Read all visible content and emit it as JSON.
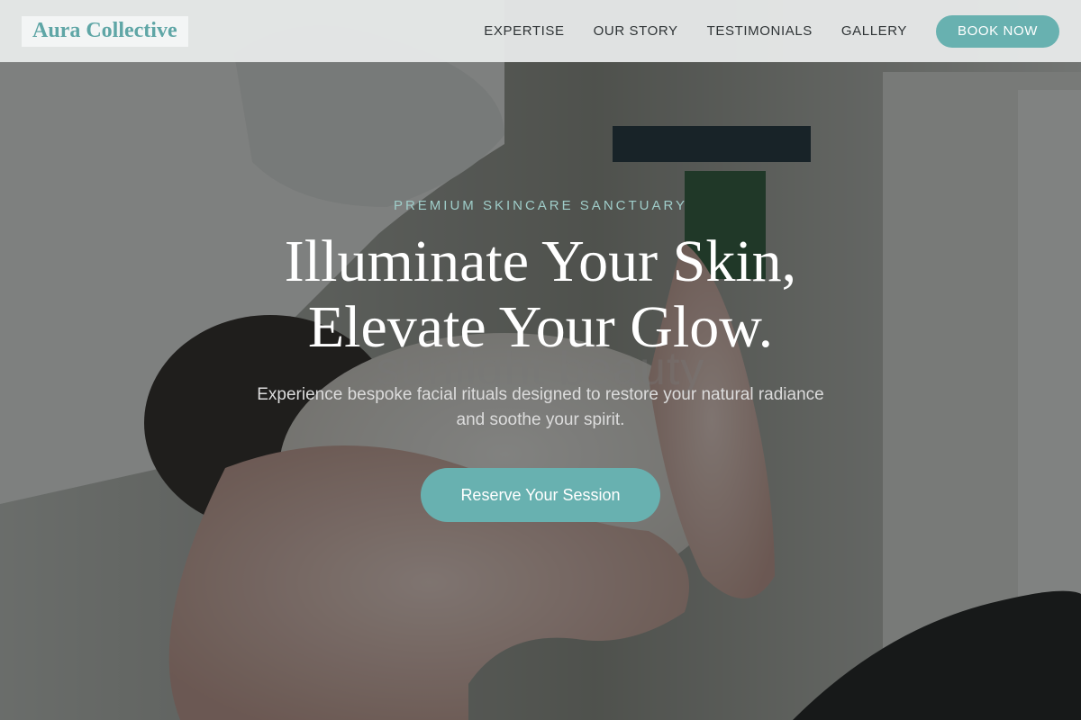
{
  "brand": {
    "name": "Aura Collective",
    "accent_color": "#68b1b0"
  },
  "nav": {
    "links": [
      "EXPERTISE",
      "OUR STORY",
      "TESTIMONIALS",
      "GALLERY"
    ],
    "cta_label": "BOOK NOW"
  },
  "hero": {
    "eyebrow": "PREMIUM SKINCARE SANCTUARY",
    "headline_line1": "Illuminate Your Skin,",
    "headline_line2": "Elevate Your Glow.",
    "ghost_text": "sunlight beauty",
    "subtext": "Experience bespoke facial rituals designed to restore your natural radiance and soothe your spirit.",
    "cta_label": "Reserve Your Session",
    "background_image": "facial-treatment-photo"
  }
}
